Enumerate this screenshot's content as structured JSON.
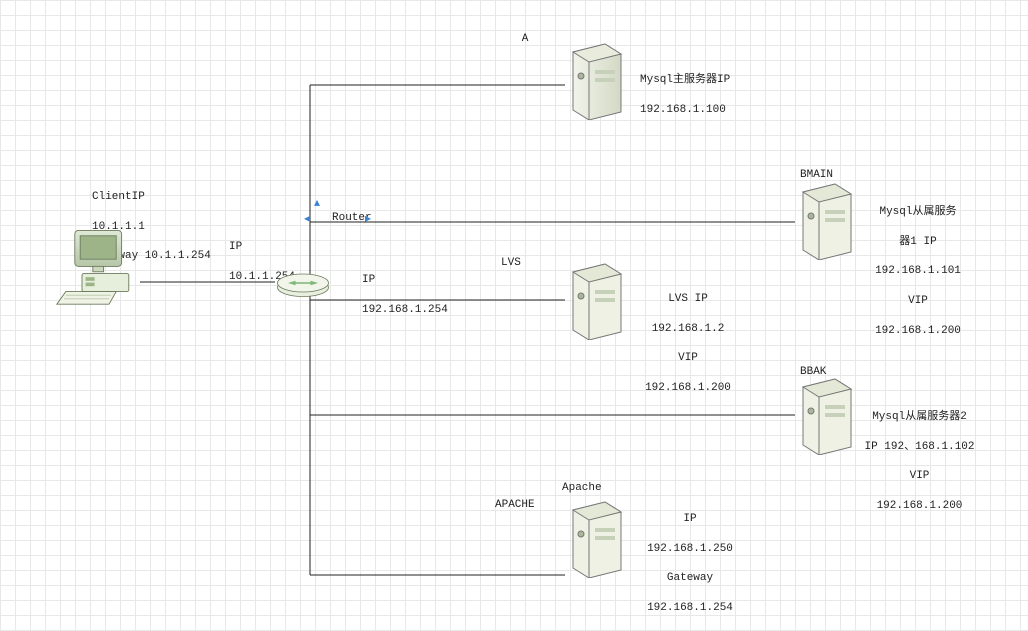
{
  "client": {
    "title": "ClientIP",
    "ip": "10.1.1.1",
    "gateway": "Gateway 10.1.1.254"
  },
  "router": {
    "label": "Router",
    "wan_label": "IP",
    "wan_ip": "10.1.1.254",
    "lan_label": "IP",
    "lan_ip": "192.168.1.254"
  },
  "nodes": {
    "a": {
      "name": "A",
      "desc1": "Mysql主服务器IP",
      "desc2": "192.168.1.100"
    },
    "bmain": {
      "name": "BMAIN",
      "desc1": "Mysql从属服务",
      "desc2": "器1 IP",
      "desc3": "192.168.1.101",
      "desc4": "VIP",
      "desc5": "192.168.1.200"
    },
    "lvs": {
      "name": "LVS",
      "desc1": "LVS IP",
      "desc2": "192.168.1.2",
      "desc3": "VIP",
      "desc4": "192.168.1.200"
    },
    "bbak": {
      "name": "BBAK",
      "desc1": "Mysql从属服务器2",
      "desc2": "IP 192、168.1.102",
      "desc3": "VIP",
      "desc4": "192.168.1.200"
    },
    "apache": {
      "name": "APACHE",
      "title": "Apache",
      "desc1": "IP",
      "desc2": "192.168.1.250",
      "desc3": "Gateway",
      "desc4": "192.168.1.254"
    }
  }
}
